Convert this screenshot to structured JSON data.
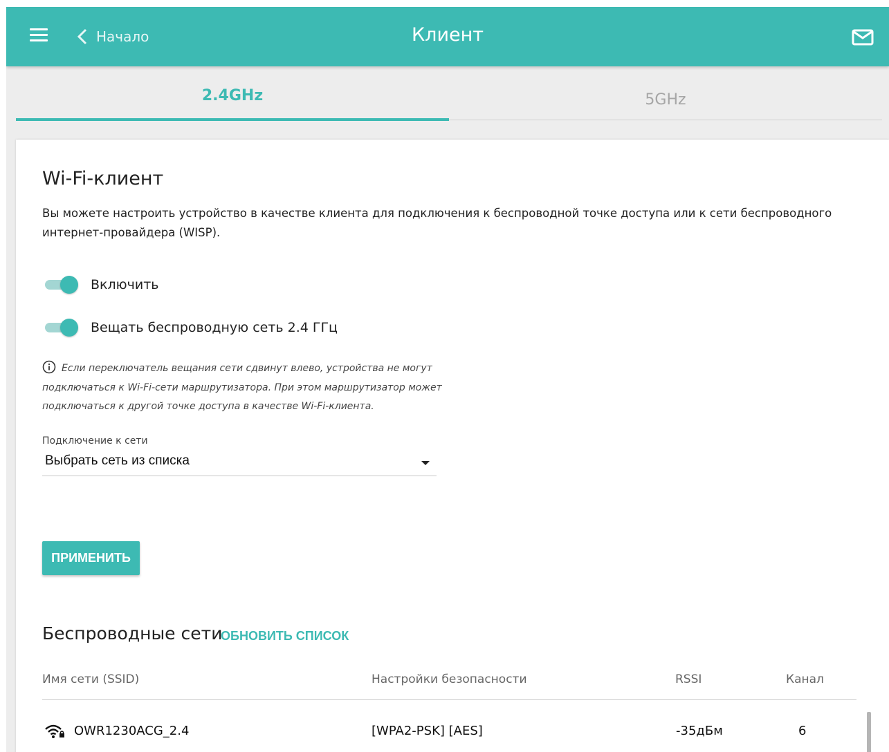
{
  "header": {
    "back_label": "Начало",
    "title": "Клиент",
    "icons": [
      "menu-icon",
      "chevron-left-icon",
      "mail-icon"
    ]
  },
  "tabs": [
    {
      "label": "2.4GHz",
      "active": true
    },
    {
      "label": "5GHz",
      "active": false
    }
  ],
  "wifi_client": {
    "title": "Wi-Fi-клиент",
    "description": "Вы можете настроить устройство в качестве клиента для подключения к беспроводной точке доступа или к сети беспроводного интернет-провайдера (WISP).",
    "toggle_enable": {
      "label": "Включить",
      "on": true
    },
    "toggle_broadcast": {
      "label": "Вещать беспроводную сеть 2.4 ГГц",
      "on": true
    },
    "note": "Если переключатель вещания сети сдвинут влево, устройства не могут подключаться к Wi-Fi-сети маршрутизатора. При этом маршрутизатор может подключаться к другой точке доступа в качестве Wi-Fi-клиента.",
    "connection": {
      "label": "Подключение к сети",
      "value": "Выбрать сеть из списка"
    },
    "apply_label": "ПРИМЕНИТЬ"
  },
  "wireless_networks": {
    "title": "Беспроводные сети",
    "refresh_label": "ОБНОВИТЬ СПИСОК",
    "columns": {
      "ssid": "Имя сети (SSID)",
      "security": "Настройки безопасности",
      "rssi": "RSSI",
      "channel": "Канал"
    },
    "rows": [
      {
        "ssid": "OWR1230ACG_2.4",
        "security": "[WPA2-PSK] [AES]",
        "rssi": "-35дБм",
        "channel": "6",
        "icon": "wifi-locked-icon"
      }
    ]
  },
  "colors": {
    "accent": "#3dbab3",
    "background": "#ededed"
  }
}
